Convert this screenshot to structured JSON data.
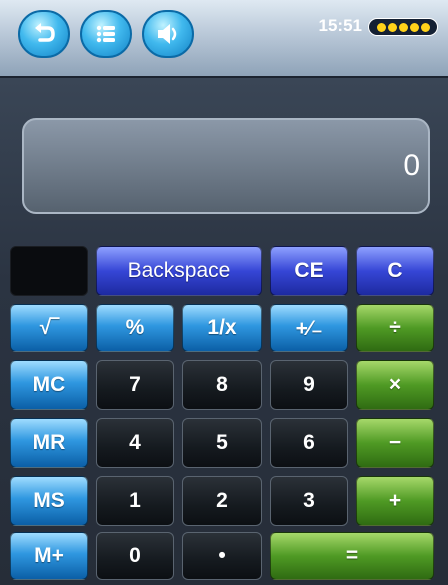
{
  "topbar": {
    "buttons": [
      "back-icon",
      "list-icon",
      "speaker-icon"
    ],
    "clock": "15:51",
    "battery": {
      "level": 1.0,
      "color": "#ffd21a"
    }
  },
  "display": {
    "value": "0"
  },
  "keys": {
    "row1": {
      "backspace": "Backspace",
      "ce": "CE",
      "c": "C"
    },
    "row2": {
      "sqrt": "√‾",
      "percent": "%",
      "reciprocal": "1/x",
      "plusminus": "+⁄₋",
      "divide": "÷"
    },
    "row3": {
      "mc": "MC",
      "seven": "7",
      "eight": "8",
      "nine": "9",
      "multiply": "×"
    },
    "row4": {
      "mr": "MR",
      "four": "4",
      "five": "5",
      "six": "6",
      "minus": "−"
    },
    "row5": {
      "ms": "MS",
      "one": "1",
      "two": "2",
      "three": "3",
      "plus": "+"
    },
    "row6": {
      "mplus": "M+",
      "zero": "0",
      "dot": "•",
      "equals": "="
    }
  },
  "colors": {
    "blue": "#2f97e0",
    "purple": "#3646d6",
    "green": "#4f9a24",
    "dark": "#151a1f"
  }
}
